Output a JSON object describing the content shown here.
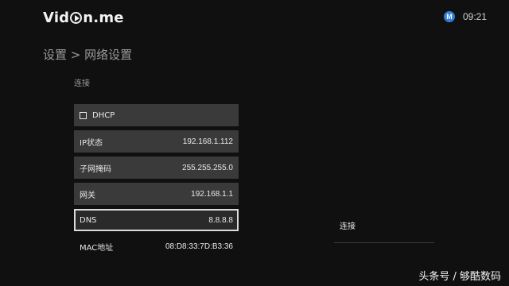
{
  "header": {
    "logo_text_1": "Vid",
    "logo_text_2": "n.me",
    "badge_letter": "M",
    "time": "09:21"
  },
  "breadcrumb": "设置 > 网络设置",
  "section_label": "连接",
  "rows": [
    {
      "label": "DHCP",
      "value": ""
    },
    {
      "label": "IP状态",
      "value": "192.168.1.112"
    },
    {
      "label": "子网掩码",
      "value": "255.255.255.0"
    },
    {
      "label": "网关",
      "value": "192.168.1.1"
    },
    {
      "label": "DNS",
      "value": "8.8.8.8"
    },
    {
      "label": "MAC地址",
      "value": "08:D8:33:7D:B3:36"
    }
  ],
  "right_panel": {
    "item": "连接"
  },
  "watermark": "头条号 / 够酷数码",
  "colors": {
    "background": "#101010",
    "row": "#3a3a3a",
    "badge": "#2f7fd6"
  }
}
